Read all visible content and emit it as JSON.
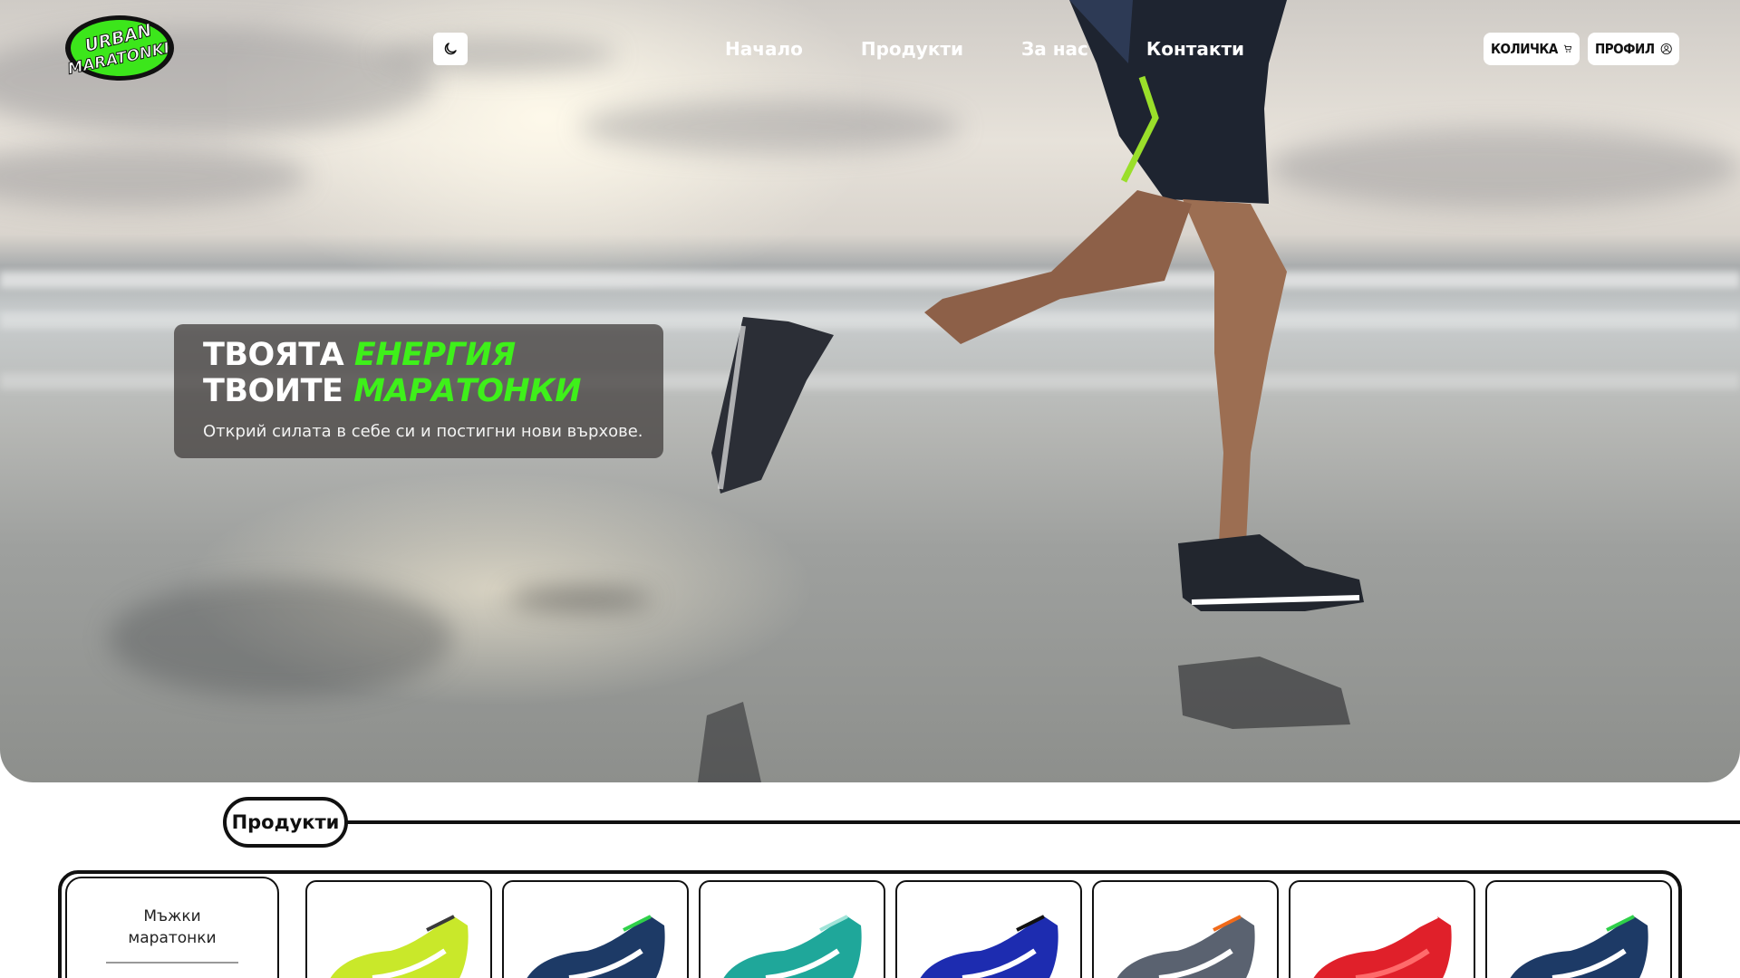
{
  "brand": {
    "logo_text_top": "URBAN",
    "logo_text_bottom": "MARATONKI"
  },
  "nav": {
    "items": [
      {
        "label": "Начало",
        "name": "nav-home"
      },
      {
        "label": "Продукти",
        "name": "nav-products"
      },
      {
        "label": "За нас",
        "name": "nav-about"
      },
      {
        "label": "Контакти",
        "name": "nav-contacts"
      }
    ]
  },
  "header": {
    "cart_label": "КОЛИЧКА",
    "profile_label": "ПРОФИЛ",
    "theme_icon": "moon-icon"
  },
  "hero": {
    "line1_white": "ТВОЯТА",
    "line1_accent": "ЕНЕРГИЯ",
    "line2_white": "ТВОИТЕ",
    "line2_accent": "МАРАТОНКИ",
    "subtitle": "Открий силата в себе си и постигни нови върхове."
  },
  "products_section": {
    "title": "Продукти",
    "category": "Мъжки маратонки",
    "cards": [
      {
        "name": "product-card-1",
        "colors": [
          "#c9e82a",
          "#3a3a3a",
          "#ffffff"
        ]
      },
      {
        "name": "product-card-2",
        "colors": [
          "#1d3a66",
          "#2fd04a",
          "#ffffff"
        ]
      },
      {
        "name": "product-card-3",
        "colors": [
          "#1fa79a",
          "#9fe4d8",
          "#ffffff"
        ]
      },
      {
        "name": "product-card-4",
        "colors": [
          "#1d2cb0",
          "#111111",
          "#ffffff"
        ]
      },
      {
        "name": "product-card-5",
        "colors": [
          "#5a6270",
          "#f06a1a",
          "#ffffff"
        ]
      },
      {
        "name": "product-card-6",
        "colors": [
          "#e0202a",
          "#ffffff",
          "#ff6b6b"
        ]
      },
      {
        "name": "product-card-7",
        "colors": [
          "#1d3a66",
          "#2fd04a",
          "#ffffff"
        ]
      }
    ]
  },
  "colors": {
    "accent": "#3ef01a",
    "text_dark": "#111111"
  }
}
